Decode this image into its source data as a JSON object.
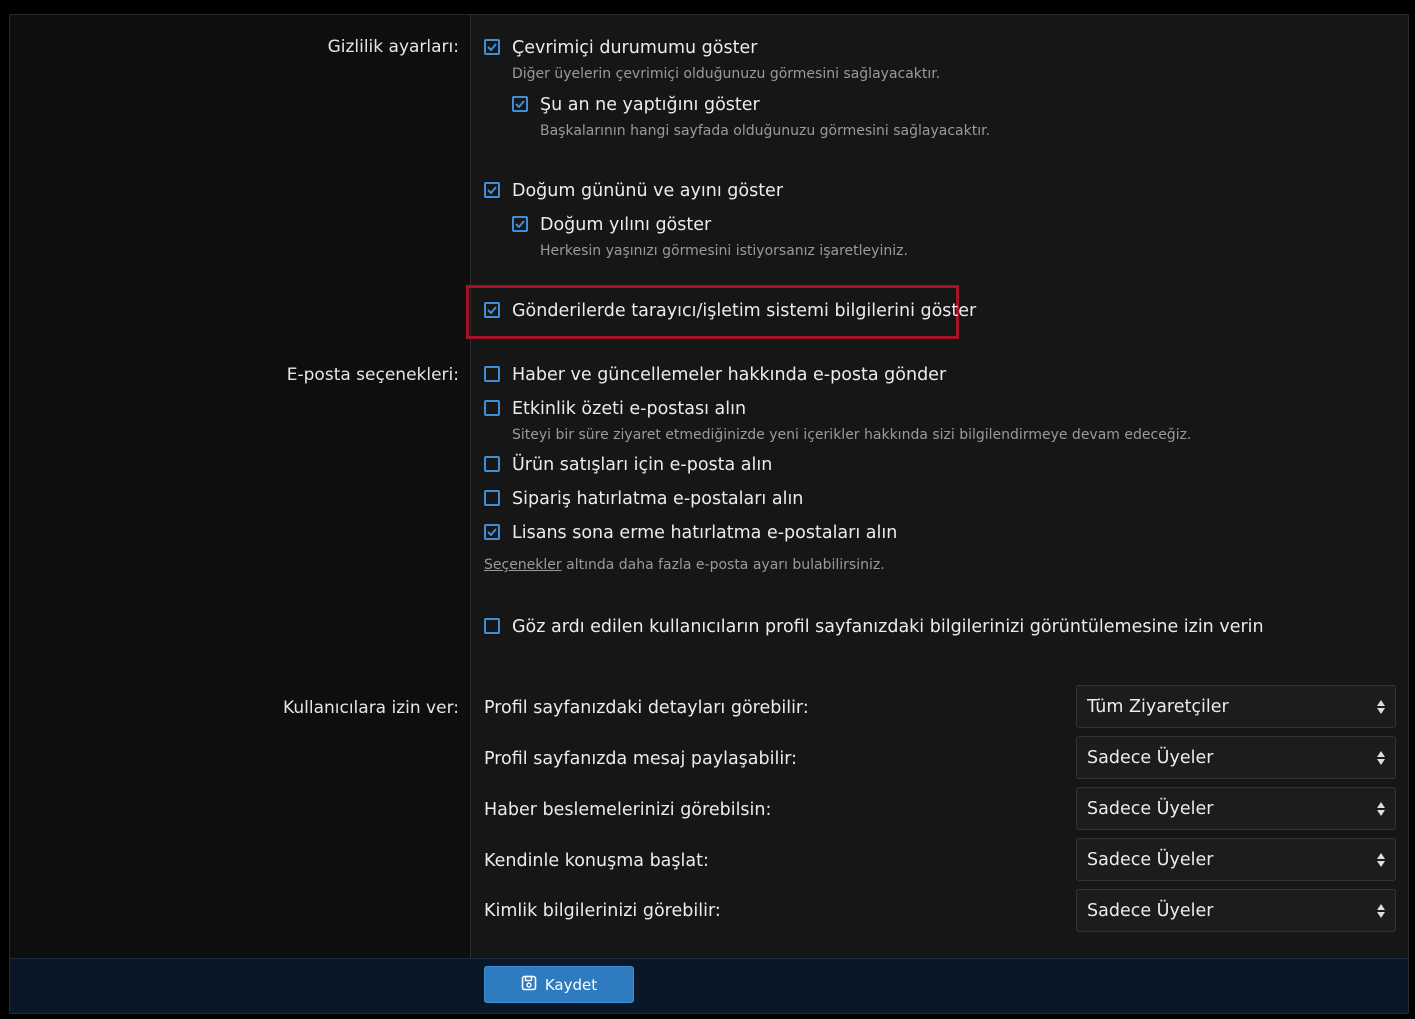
{
  "privacy": {
    "label": "Gizlilik ayarları:",
    "options": [
      {
        "label": "Çevrimiçi durumumu göster",
        "hint": "Diğer üyelerin çevrimiçi olduğunuzu görmesini sağlayacaktır.",
        "checked": true
      },
      {
        "label": "Şu an ne yaptığını göster",
        "hint": "Başkalarının hangi sayfada olduğunuzu görmesini sağlayacaktır.",
        "checked": true
      },
      {
        "label": "Doğum gününü ve ayını göster",
        "hint": "",
        "checked": true
      },
      {
        "label": "Doğum yılını göster",
        "hint": "Herkesin yaşınızı görmesini istiyorsanız işaretleyiniz.",
        "checked": true
      },
      {
        "label": "Gönderilerde tarayıcı/işletim sistemi bilgilerini göster",
        "hint": "",
        "checked": true
      }
    ]
  },
  "email": {
    "label": "E-posta seçenekleri:",
    "options": [
      {
        "label": "Haber ve güncellemeler hakkında e-posta gönder",
        "hint": "",
        "checked": false
      },
      {
        "label": "Etkinlik özeti e-postası alın",
        "hint": "Siteyi bir süre ziyaret etmediğinizde yeni içerikler hakkında sizi bilgilendirmeye devam edeceğiz.",
        "checked": false
      },
      {
        "label": "Ürün satışları için e-posta alın",
        "hint": "",
        "checked": false
      },
      {
        "label": "Sipariş hatırlatma e-postaları alın",
        "hint": "",
        "checked": false
      },
      {
        "label": "Lisans sona erme hatırlatma e-postaları alın",
        "hint": "",
        "checked": true
      }
    ],
    "note_link": "Seçenekler",
    "note_text": " altında daha fazla e-posta ayarı bulabilirsiniz."
  },
  "ignored": {
    "label": "Göz ardı edilen kullanıcıların profil sayfanızdaki bilgilerinizi görüntülemesine izin verin",
    "checked": false
  },
  "permissions": {
    "label": "Kullanıcılara izin ver:",
    "items": [
      {
        "label": "Profil sayfanızdaki detayları görebilir:",
        "value": "Tüm Ziyaretçiler"
      },
      {
        "label": "Profil sayfanızda mesaj paylaşabilir:",
        "value": "Sadece Üyeler"
      },
      {
        "label": "Haber beslemelerinizi görebilsin:",
        "value": "Sadece Üyeler"
      },
      {
        "label": "Kendinle konuşma başlat:",
        "value": "Sadece Üyeler"
      },
      {
        "label": "Kimlik bilgilerinizi görebilir:",
        "value": "Sadece Üyeler"
      }
    ]
  },
  "save_label": "Kaydet",
  "colors": {
    "accent": "#3f8ed8",
    "highlight": "#a5122a",
    "button": "#2f7bbf"
  }
}
